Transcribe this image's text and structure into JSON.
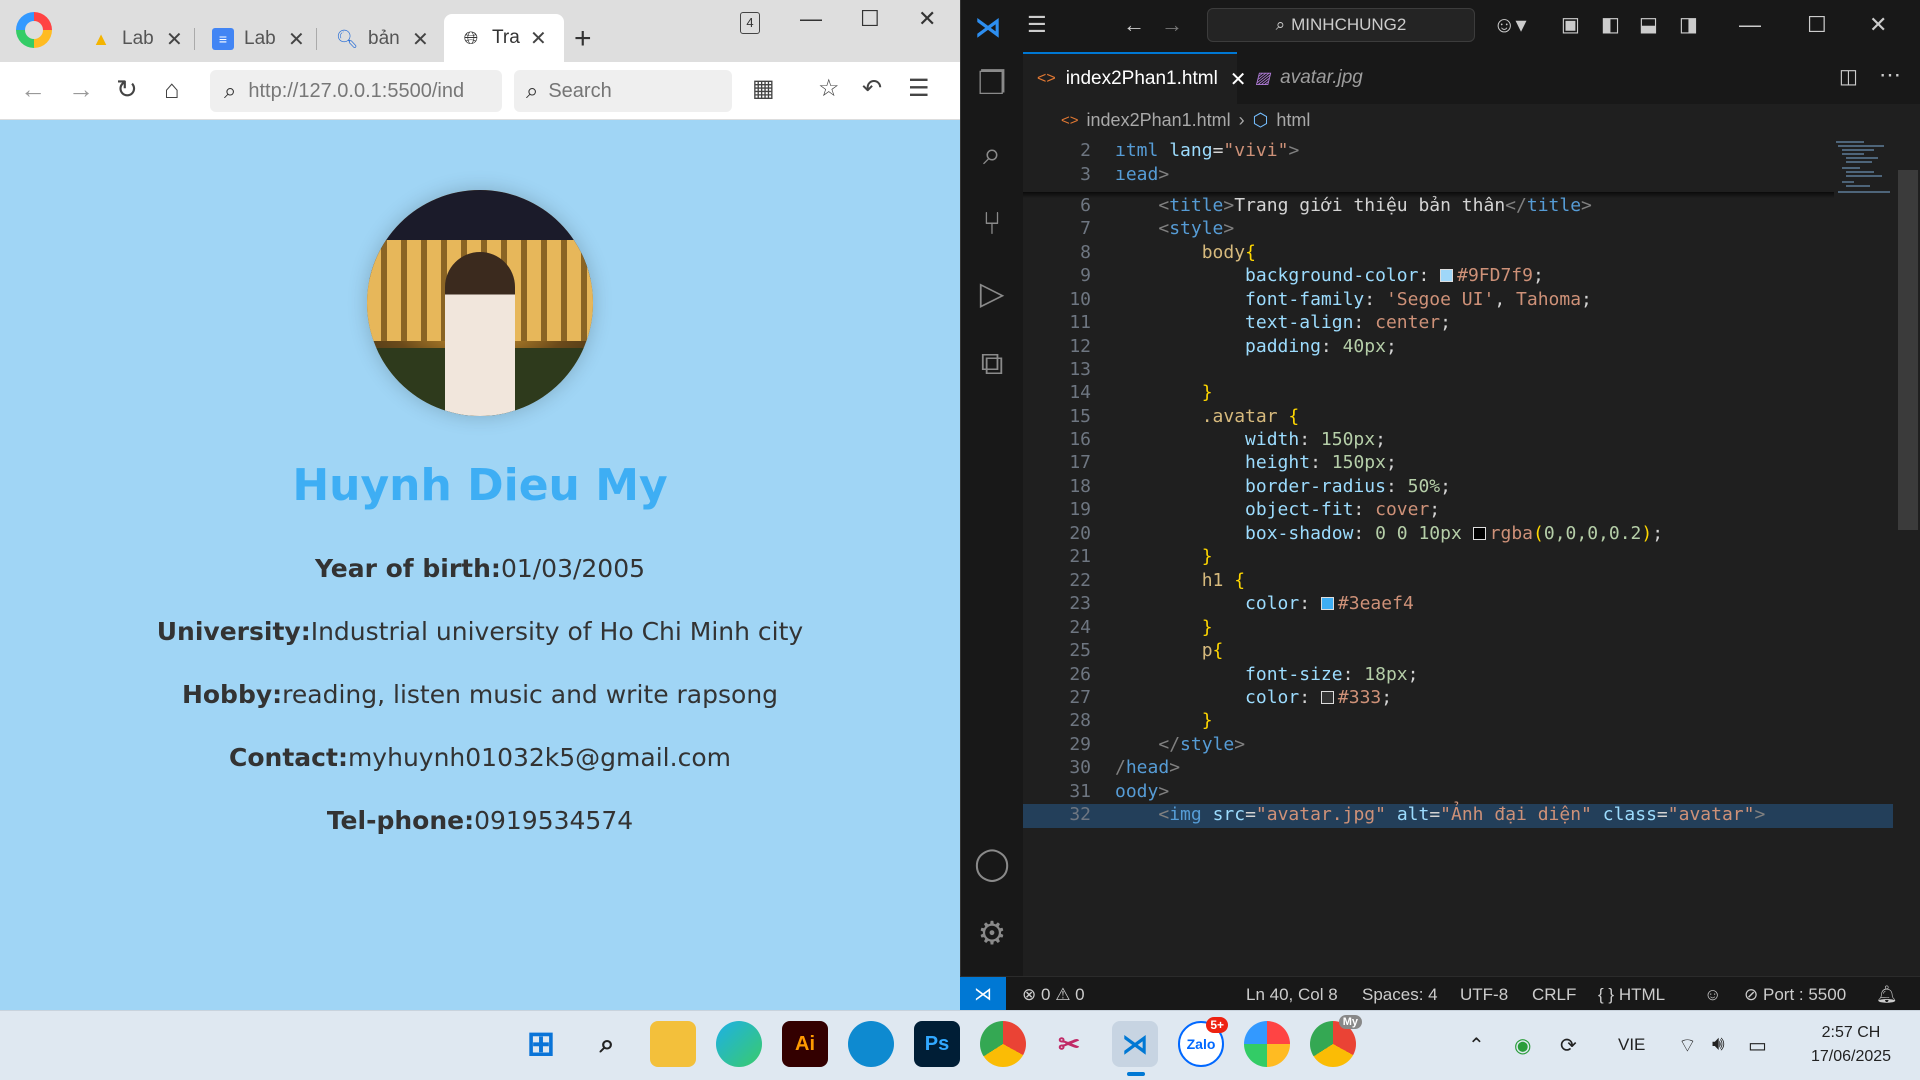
{
  "browser": {
    "tabs": [
      {
        "title": "Lab",
        "icon": "google-drive-icon"
      },
      {
        "title": "Lab",
        "icon": "google-docs-icon"
      },
      {
        "title": "bản",
        "icon": "search-icon"
      },
      {
        "title": "Trai",
        "icon": "globe-icon"
      }
    ],
    "tab_count": "4",
    "url": "http://127.0.0.1:5500/ind",
    "search_placeholder": "Search"
  },
  "page": {
    "name": "Huynh Dieu My",
    "fields": [
      {
        "label": "Year of birth:",
        "value": "01/03/2005"
      },
      {
        "label": "University:",
        "value": "Industrial university of Ho Chi Minh city"
      },
      {
        "label": "Hobby:",
        "value": "reading, listen music and write rapsong"
      },
      {
        "label": "Contact:",
        "value": "myhuynh01032k5@gmail.com"
      },
      {
        "label": "Tel-phone:",
        "value": "0919534574"
      }
    ],
    "background": "#9FD7f9",
    "heading_color": "#3eaef4"
  },
  "vscode": {
    "command_center": "MINHCHUNG2",
    "tabs": [
      {
        "label": "index2Phan1.html",
        "icon": "html-file-icon"
      },
      {
        "label": "avatar.jpg",
        "icon": "image-file-icon"
      }
    ],
    "breadcrumb": {
      "file": "index2Phan1.html",
      "element": "html"
    },
    "lines": [
      {
        "n": "2",
        "text": "ıtml lang=\"vivi\">"
      },
      {
        "n": "3",
        "text": "ıead>"
      },
      {
        "n": "6",
        "text": "<title>Trang giới thiệu bản thân</title>"
      },
      {
        "n": "7",
        "text": "<style>"
      },
      {
        "n": "8",
        "text": "body{"
      },
      {
        "n": "9",
        "text": "background-color: #9FD7f9;"
      },
      {
        "n": "10",
        "text": "font-family: 'Segoe UI', Tahoma;"
      },
      {
        "n": "11",
        "text": "text-align: center;"
      },
      {
        "n": "12",
        "text": "padding: 40px;"
      },
      {
        "n": "13",
        "text": ""
      },
      {
        "n": "14",
        "text": "}"
      },
      {
        "n": "15",
        "text": ".avatar {"
      },
      {
        "n": "16",
        "text": "width: 150px;"
      },
      {
        "n": "17",
        "text": "height: 150px;"
      },
      {
        "n": "18",
        "text": "border-radius: 50%;"
      },
      {
        "n": "19",
        "text": "object-fit: cover;"
      },
      {
        "n": "20",
        "text": "box-shadow: 0 0 10px rgba(0,0,0,0.2);"
      },
      {
        "n": "21",
        "text": "}"
      },
      {
        "n": "22",
        "text": "h1 {"
      },
      {
        "n": "23",
        "text": "color: #3eaef4"
      },
      {
        "n": "24",
        "text": "}"
      },
      {
        "n": "25",
        "text": "p{"
      },
      {
        "n": "26",
        "text": "font-size: 18px;"
      },
      {
        "n": "27",
        "text": "color: #333;"
      },
      {
        "n": "28",
        "text": "}"
      },
      {
        "n": "29",
        "text": "</style>"
      },
      {
        "n": "30",
        "text": "/head>"
      },
      {
        "n": "31",
        "text": "oody>"
      },
      {
        "n": "32",
        "text": "<img src=\"avatar.jpg\" alt=\"Ảnh đại diện\" class=\"avatar\">"
      }
    ],
    "status": {
      "errors": "0",
      "warnings": "0",
      "cursor": "Ln 40, Col 8",
      "spaces": "Spaces: 4",
      "encoding": "UTF-8",
      "eol": "CRLF",
      "language": "HTML",
      "port": "Port : 5500"
    }
  },
  "taskbar": {
    "apps": [
      "windows-start",
      "search",
      "file-explorer",
      "edge",
      "illustrator",
      "browser-app",
      "photoshop",
      "chrome",
      "snipping-tool",
      "vscode",
      "zalo",
      "browser-ring",
      "chrome-profile"
    ],
    "zalo_badge": "5+",
    "chrome_profile_badge": "My",
    "language": "VIE",
    "time": "2:57 CH",
    "date": "17/06/2025"
  }
}
